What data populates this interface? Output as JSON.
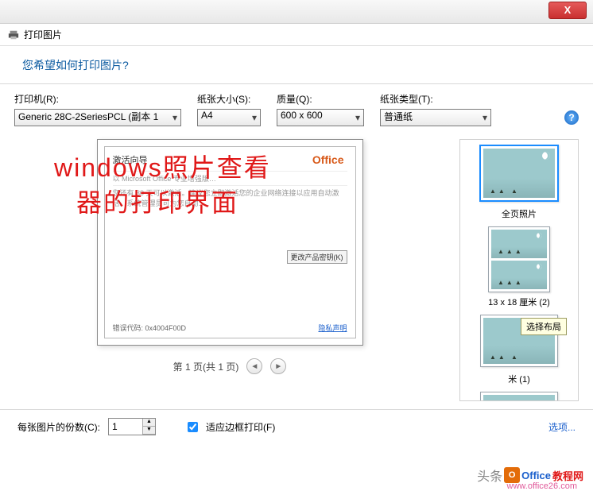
{
  "titlebar": {
    "close": "X"
  },
  "window": {
    "title": "打印图片"
  },
  "question": "您希望如何打印图片?",
  "controls": {
    "printer": {
      "label": "打印机(R):",
      "value": "Generic 28C-2SeriesPCL (副本 1"
    },
    "paper": {
      "label": "纸张大小(S):",
      "value": "A4"
    },
    "quality": {
      "label": "质量(Q):",
      "value": "600 x 600"
    },
    "type": {
      "label": "纸张类型(T):",
      "value": "普通纸"
    },
    "help": "?"
  },
  "preview": {
    "activation_title": "激活向导",
    "office_badge": "Office",
    "line1": "以 Microsoft Office 专业增强版…",
    "line2": "您还有 30 天可以激活。建议您立即激活您的企业网络连接以应用自动激活。系统管理员可为您自动…",
    "change_btn": "更改产品密钥(K)",
    "code_label": "错误代码: 0x4004F00D",
    "privacy_link": "隐私声明"
  },
  "overlay": {
    "line1": "windows照片查看",
    "line2": "器的打印界面"
  },
  "pager": {
    "text": "第 1 页(共 1 页)"
  },
  "layouts": {
    "full": "全页照片",
    "grid2": "13 x 18 厘米 (2)",
    "grid1": "米 (1)",
    "tooltip": "选择布局"
  },
  "bottom": {
    "copies_label": "每张图片的份数(C):",
    "copies_value": "1",
    "fit_label": "适应边框打印(F)",
    "options": "选项..."
  },
  "watermark": {
    "head": "头条",
    "office": "Office",
    "jiaocheng": "教程网",
    "url": "www.office26.com"
  }
}
